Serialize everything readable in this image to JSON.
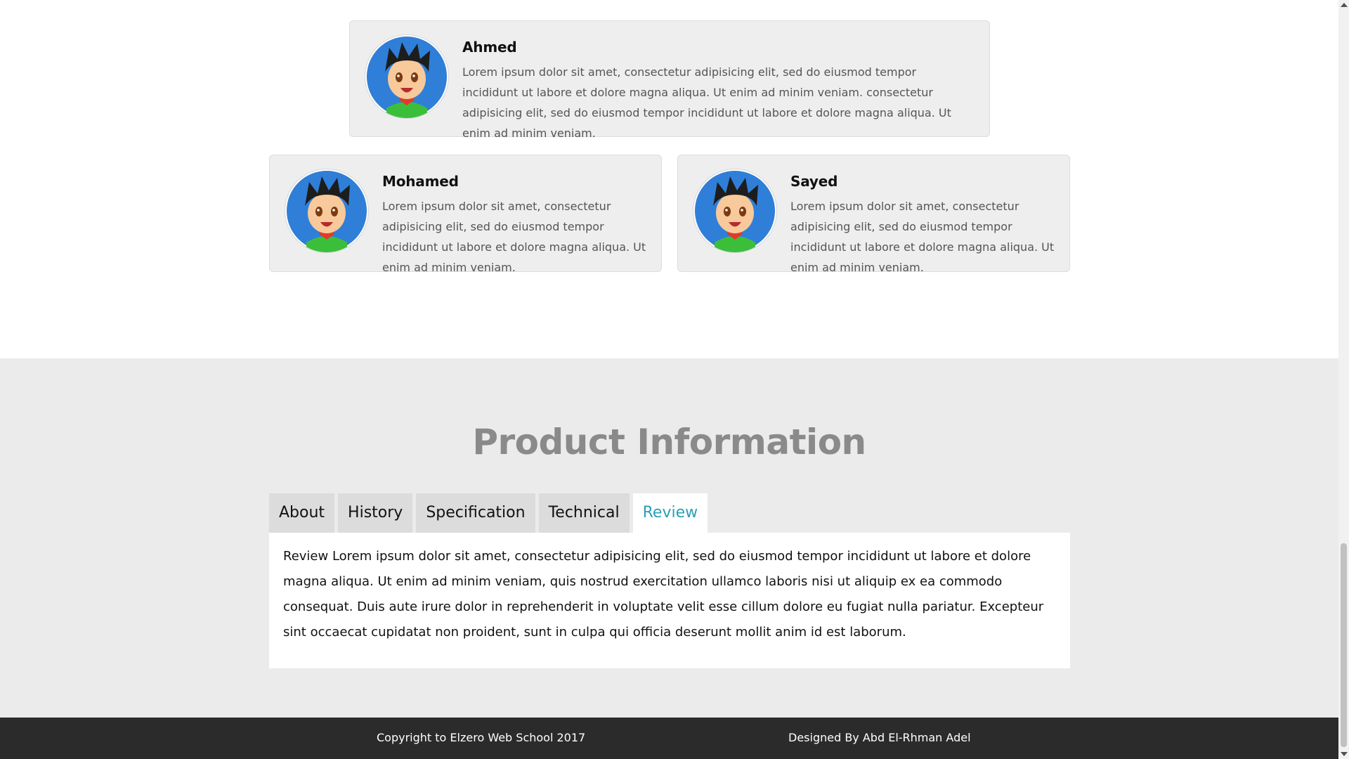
{
  "testimonials": [
    {
      "name": "Ahmed",
      "text": "Lorem ipsum dolor sit amet, consectetur adipisicing elit, sed do eiusmod tempor incididunt ut labore et dolore magna aliqua. Ut enim ad minim veniam. consectetur adipisicing elit, sed do eiusmod tempor incididunt ut labore et dolore magna aliqua. Ut enim ad minim veniam.",
      "avatar_icon": "anime-boy-avatar-icon"
    },
    {
      "name": "Mohamed",
      "text": "Lorem ipsum dolor sit amet, consectetur adipisicing elit, sed do eiusmod tempor incididunt ut labore et dolore magna aliqua. Ut enim ad minim veniam.",
      "avatar_icon": "anime-boy-avatar-icon"
    },
    {
      "name": "Sayed",
      "text": "Lorem ipsum dolor sit amet, consectetur adipisicing elit, sed do eiusmod tempor incididunt ut labore et dolore magna aliqua. Ut enim ad minim veniam.",
      "avatar_icon": "anime-boy-avatar-icon"
    }
  ],
  "product": {
    "title": "Product Information",
    "tabs": [
      {
        "label": "About",
        "active": false
      },
      {
        "label": "History",
        "active": false
      },
      {
        "label": "Specification",
        "active": false
      },
      {
        "label": "Technical",
        "active": false
      },
      {
        "label": "Review",
        "active": true
      }
    ],
    "panel_text": "Review Lorem ipsum dolor sit amet, consectetur adipisicing elit, sed do eiusmod tempor incididunt ut labore et dolore magna aliqua. Ut enim ad minim veniam, quis nostrud exercitation ullamco laboris nisi ut aliquip ex ea commodo consequat. Duis aute irure dolor in reprehenderit in voluptate velit esse cillum dolore eu fugiat nulla pariatur. Excepteur sint occaecat cupidatat non proident, sunt in culpa qui officia deserunt mollit anim id est laborum."
  },
  "footer": {
    "copyright": "Copyright to Elzero Web School 2017",
    "designer": "Designed By Abd El-Rhman Adel"
  },
  "colors": {
    "active_tab": "#2aa0b5",
    "title_gray": "#8a8a8a",
    "footer_bg": "#2b2b2b"
  }
}
